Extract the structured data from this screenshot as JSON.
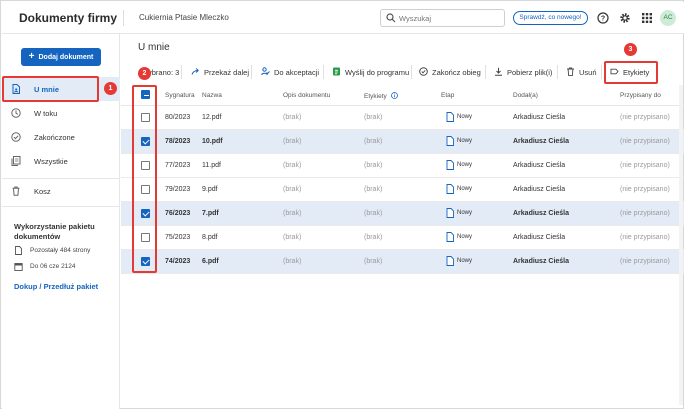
{
  "header": {
    "app_title": "Dokumenty firmy",
    "company": "Cukiernia Ptasie Mleczko",
    "search_placeholder": "Wyszukaj",
    "whats_new": "Sprawdź, co nowego!",
    "avatar": "AC",
    "icons": [
      "search-icon",
      "help-icon",
      "gear-icon",
      "apps-grid-icon"
    ]
  },
  "sidebar": {
    "add_button": "Dodaj dokument",
    "items": [
      {
        "label": "U mnie",
        "icon": "document-user-icon",
        "active": true
      },
      {
        "label": "W toku",
        "icon": "clock-icon"
      },
      {
        "label": "Zakończone",
        "icon": "check-circle-icon"
      },
      {
        "label": "Wszystkie",
        "icon": "documents-icon"
      },
      {
        "label": "Kosz",
        "icon": "trash-icon"
      }
    ],
    "quota": {
      "title": "Wykorzystanie pakietu dokumentów",
      "pages_left": "Pozostały 484 strony",
      "valid_until": "Do 06 cze 2124",
      "buy_link": "Dokup / Przedłuż pakiet"
    }
  },
  "main": {
    "title": "U mnie",
    "selected_label": "Wybrano: 3",
    "toolbar": [
      {
        "label": "Przekaż dalej",
        "icon": "forward-icon"
      },
      {
        "label": "Do akceptacji",
        "icon": "approval-user-icon"
      },
      {
        "label": "Wyślij do programu",
        "icon": "send-to-program-icon"
      },
      {
        "label": "Zakończ obieg",
        "icon": "finish-circle-icon"
      },
      {
        "label": "Pobierz plik(i)",
        "icon": "download-icon"
      },
      {
        "label": "Usuń",
        "icon": "trash-icon"
      },
      {
        "label": "Etykiety",
        "icon": "label-tag-icon"
      }
    ],
    "columns": [
      "Sygnatura",
      "Nazwa",
      "Opis dokumentu",
      "Etykiety",
      "Etap",
      "Dodał(a)",
      "Przypisany do"
    ],
    "rows": [
      {
        "sig": "80/2023",
        "name": "12.pdf",
        "desc": "(brak)",
        "labels": "(brak)",
        "stage": "Nowy",
        "added_by": "Arkadiusz Cieśla",
        "assigned": "(nie przypisano)",
        "selected": false
      },
      {
        "sig": "78/2023",
        "name": "10.pdf",
        "desc": "(brak)",
        "labels": "(brak)",
        "stage": "Nowy",
        "added_by": "Arkadiusz Cieśla",
        "assigned": "(nie przypisano)",
        "selected": true
      },
      {
        "sig": "77/2023",
        "name": "11.pdf",
        "desc": "(brak)",
        "labels": "(brak)",
        "stage": "Nowy",
        "added_by": "Arkadiusz Cieśla",
        "assigned": "(nie przypisano)",
        "selected": false
      },
      {
        "sig": "79/2023",
        "name": "9.pdf",
        "desc": "(brak)",
        "labels": "(brak)",
        "stage": "Nowy",
        "added_by": "Arkadiusz Cieśla",
        "assigned": "(nie przypisano)",
        "selected": false
      },
      {
        "sig": "76/2023",
        "name": "7.pdf",
        "desc": "(brak)",
        "labels": "(brak)",
        "stage": "Nowy",
        "added_by": "Arkadiusz Cieśla",
        "assigned": "(nie przypisano)",
        "selected": true
      },
      {
        "sig": "75/2023",
        "name": "8.pdf",
        "desc": "(brak)",
        "labels": "(brak)",
        "stage": "Nowy",
        "added_by": "Arkadiusz Cieśla",
        "assigned": "(nie przypisano)",
        "selected": false
      },
      {
        "sig": "74/2023",
        "name": "6.pdf",
        "desc": "(brak)",
        "labels": "(brak)",
        "stage": "Nowy",
        "added_by": "Arkadiusz Cieśla",
        "assigned": "(nie przypisano)",
        "selected": true
      }
    ]
  },
  "annotations": [
    "1",
    "2",
    "3"
  ],
  "colors": {
    "accent": "#1565c0",
    "selected_row": "#e3ebf7",
    "highlight": "#e53935"
  }
}
